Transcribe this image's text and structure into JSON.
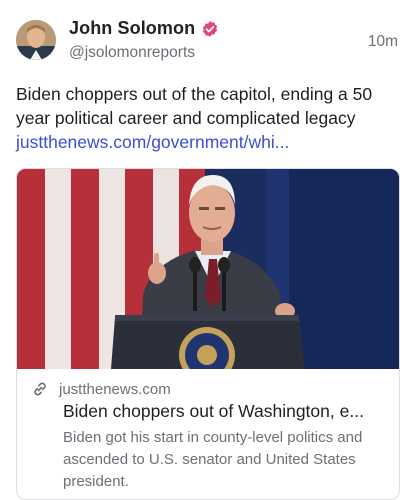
{
  "author": {
    "name": "John Solomon",
    "handle": "@jsolomonreports",
    "time": "10m",
    "verified_color": "#e0457b"
  },
  "post": {
    "text": "Biden choppers out of the capitol, ending a 50 year political career and complicated legacy ",
    "link_text": "justthenews.com/government/whi..."
  },
  "link_card": {
    "domain": "justthenews.com",
    "title": "Biden choppers out of Washington, e...",
    "description": "Biden got his start in county-level politics and ascended to U.S. senator and United States president."
  },
  "colors": {
    "link": "#3b4ed6",
    "muted": "#6e6e78",
    "text": "#1f1f24"
  },
  "icons": [
    "verified-icon",
    "link-icon"
  ]
}
